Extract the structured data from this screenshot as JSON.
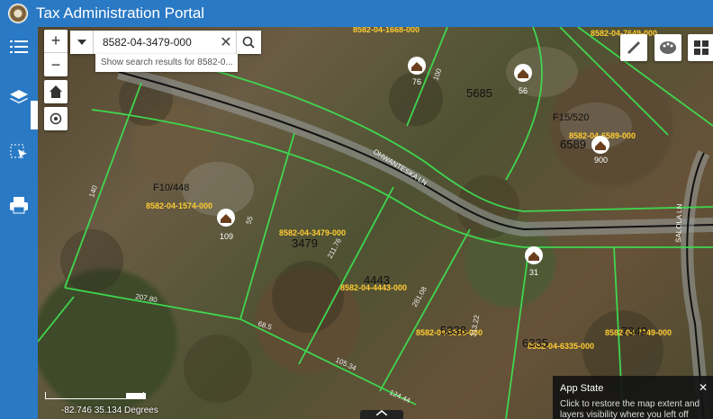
{
  "header": {
    "title": "Tax Administration Portal"
  },
  "sidebar": {
    "items": [
      {
        "name": "layer-list",
        "icon": "list-icon"
      },
      {
        "name": "layers",
        "icon": "layers-icon"
      },
      {
        "name": "analysis",
        "icon": "select-icon"
      },
      {
        "name": "print",
        "icon": "print-icon"
      }
    ]
  },
  "search": {
    "value": "8582-04-3479-000",
    "suggestion": "Show search results for 8582-0..."
  },
  "map": {
    "parcel_ids": [
      "8582-04-1574-000",
      "8582-04-3479-000",
      "8582-04-4443-000",
      "8582-04-5338-000",
      "8582-04-6335-000",
      "8582-04-7349-000",
      "8582-04-6589-000",
      "8582-04-7649-000",
      "8582-04-1668-000"
    ],
    "lot_numbers": [
      "3479",
      "4443",
      "5685",
      "6589",
      "5338",
      "6335",
      "7349"
    ],
    "plat_refs": [
      "F10/448",
      "F15/520"
    ],
    "road_names": [
      "OHWANTESKA LN",
      "SALOLA LN"
    ],
    "addresses": [
      "109",
      "76",
      "56",
      "900",
      "31"
    ],
    "dimensions": [
      "140",
      "207.80",
      "68.5",
      "211.76",
      "105.34",
      "124.44",
      "281.08",
      "313.22",
      "100",
      "55"
    ]
  },
  "status": {
    "coordinates": "-82.746 35.134 Degrees"
  },
  "toast": {
    "title": "App State",
    "text": "Click to restore the map extent and layers visibility where you left off"
  },
  "colors": {
    "brand": "#2a79c4",
    "parcel_line": "#3fd64f",
    "parcel_label": "#ffcc33"
  }
}
